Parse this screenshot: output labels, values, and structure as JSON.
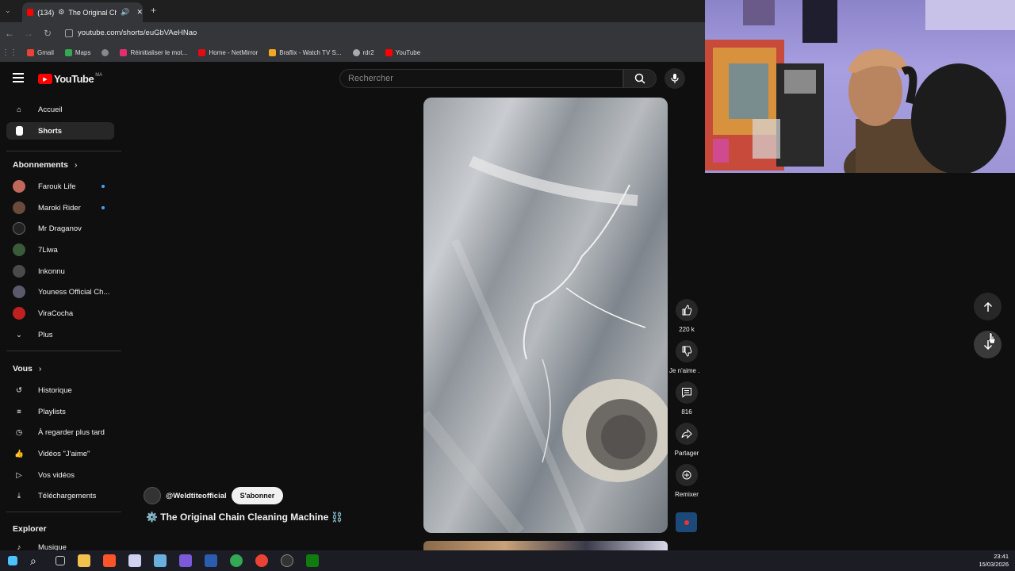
{
  "browser": {
    "tab_title": "(134) 🔊 The Original Chain",
    "tab_count_label": "(134)",
    "tab_text": "The Original Chai",
    "url": "youtube.com/shorts/euGbVAeHNao",
    "bookmarks": [
      {
        "label": "Gmail",
        "color": "#ea4335"
      },
      {
        "label": "Maps",
        "color": "#34a853"
      },
      {
        "label": "",
        "color": "#888888"
      },
      {
        "label": "Réinitialiser le mot...",
        "color": "#e1306c"
      },
      {
        "label": "Home - NetMirror",
        "color": "#e50914"
      },
      {
        "label": "Braflix - Watch TV S...",
        "color": "#f5a623"
      },
      {
        "label": "rdr2",
        "color": "#aaaaaa"
      },
      {
        "label": "YouTube",
        "color": "#ff0000"
      }
    ]
  },
  "youtube": {
    "logo_text": "YouTube",
    "country_code": "MA",
    "search_placeholder": "Rechercher"
  },
  "sidebar": {
    "top": [
      {
        "label": "Accueil",
        "icon": "home-icon"
      },
      {
        "label": "Shorts",
        "icon": "shorts-icon",
        "active": true
      }
    ],
    "subscriptions_title": "Abonnements",
    "subscriptions": [
      {
        "label": "Farouk Life",
        "dot": true,
        "color": "#c0685a"
      },
      {
        "label": "Maroki Rider",
        "dot": true,
        "color": "#6a4a3a"
      },
      {
        "label": "Mr Draganov",
        "dot": false,
        "color": "#222222"
      },
      {
        "label": "7Liwa",
        "dot": false,
        "color": "#3a5a3a"
      },
      {
        "label": "Inkonnu",
        "dot": false,
        "color": "#4a4a4a"
      },
      {
        "label": "Youness Official Ch...",
        "dot": false,
        "color": "#5a5a6a"
      },
      {
        "label": "ViraCocha",
        "dot": false,
        "color": "#c02020"
      },
      {
        "label": "Plus",
        "dot": false,
        "color": ""
      }
    ],
    "you_title": "Vous",
    "you": [
      {
        "label": "Historique",
        "icon": "history-icon"
      },
      {
        "label": "Playlists",
        "icon": "playlist-icon"
      },
      {
        "label": "À regarder plus tard",
        "icon": "watch-later-icon"
      },
      {
        "label": "Vidéos \"J'aime\"",
        "icon": "like-icon"
      },
      {
        "label": "Vos vidéos",
        "icon": "your-videos-icon"
      },
      {
        "label": "Téléchargements",
        "icon": "download-icon"
      }
    ],
    "explore_title": "Explorer",
    "explore": [
      {
        "label": "Musique",
        "icon": "music-icon"
      }
    ]
  },
  "short": {
    "channel": "@Weldtiteofficial",
    "subscribe_label": "S'abonner",
    "title": "⚙️ The Original Chain Cleaning Machine ⛓️",
    "likes": "220 k",
    "dislike_label": "Je n'aime .",
    "comments": "816",
    "share_label": "Partager",
    "remix_label": "Remixer"
  },
  "taskbar": {
    "time": "23:41",
    "date": "15/03/2026"
  }
}
